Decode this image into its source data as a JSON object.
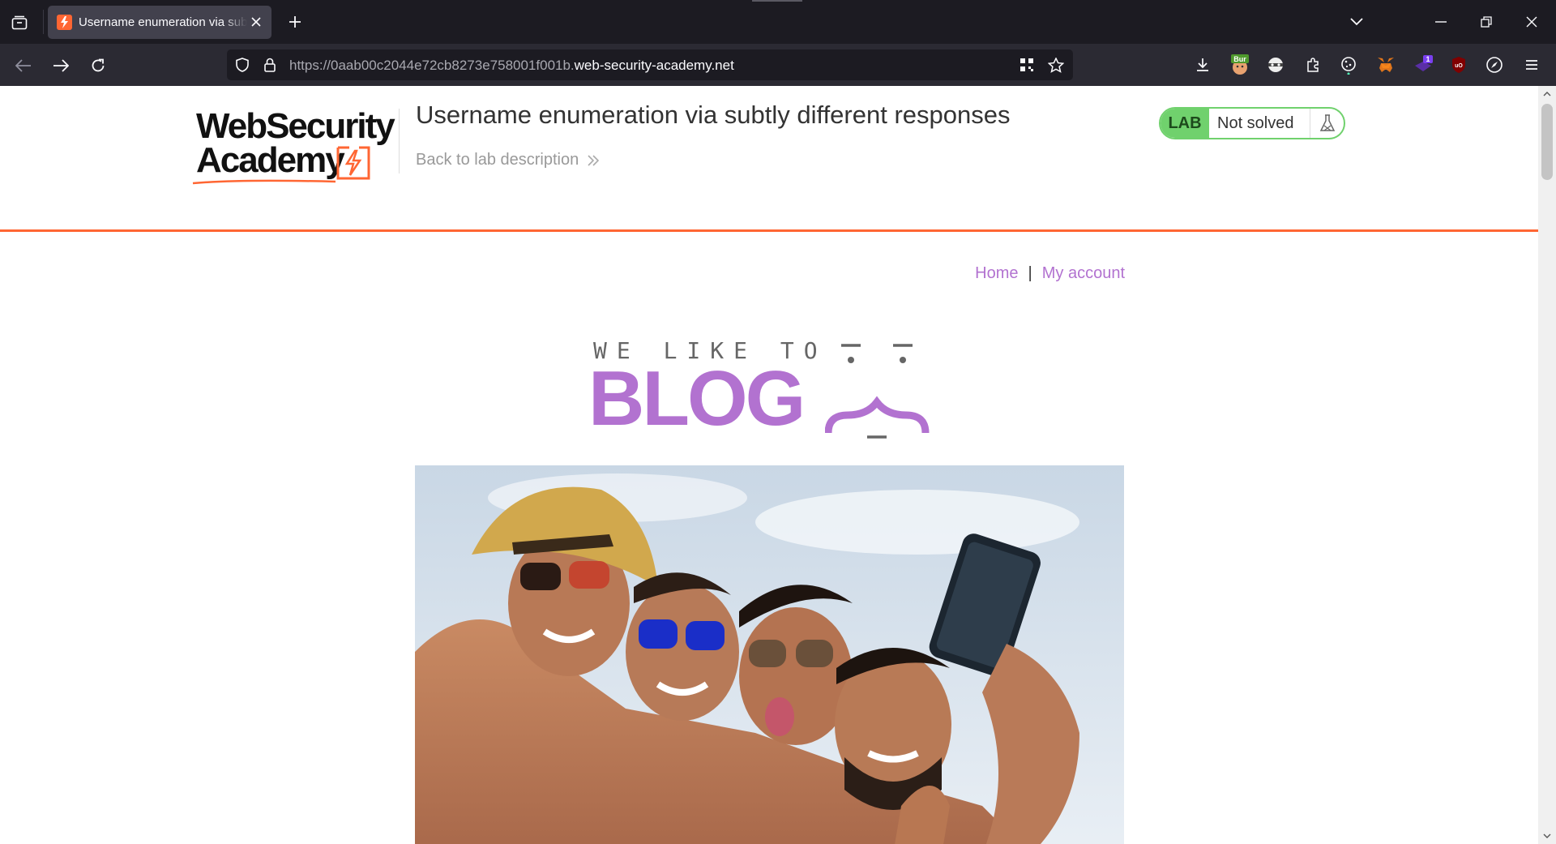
{
  "browser": {
    "tab_title": "Username enumeration via subtly different responses",
    "url_prefix": "https://0aab00c2044e72cb8273e758001f001b.",
    "url_domain": "web-security-academy.net",
    "extensions": [
      "burp-icon",
      "privacy-badger-icon",
      "extensions-icon",
      "cookie-icon",
      "metamask-icon",
      "notifier-icon",
      "ublock-origin-icon",
      "compass-icon",
      "menu-icon"
    ],
    "ext_badge_burp": "Bur",
    "ext_badge_count": "1",
    "ublock_label": "uO"
  },
  "lab": {
    "logo_line1": "WebSecurity",
    "logo_line2": "Academy",
    "title": "Username enumeration via subtly different responses",
    "back_link": "Back to lab description",
    "badge": "LAB",
    "status": "Not solved"
  },
  "nav": {
    "home": "Home",
    "separator": "|",
    "account": "My account"
  },
  "banner": {
    "tagline": "WE LIKE TO",
    "word": "BLOG"
  },
  "colors": {
    "accent_orange": "#ff6633",
    "link_purple": "#b272d0",
    "lab_green": "#70d16d",
    "chrome_dark": "#1c1b22"
  }
}
